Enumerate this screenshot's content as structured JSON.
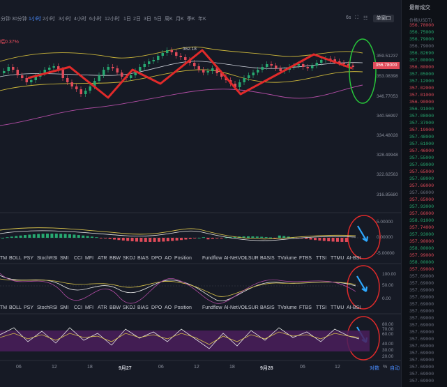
{
  "toolbar": {
    "timeframes": [
      "分钟",
      "30分钟",
      "1小时",
      "2小时",
      "3小时",
      "4小时",
      "6小时",
      "12小时",
      "1日",
      "2日",
      "3日",
      "5日",
      "周K",
      "月K",
      "季K",
      "年K"
    ],
    "active_timeframe": "1小时",
    "interval_label": "6s",
    "window_button": "单窗口"
  },
  "price": {
    "change_label": "幅0.37%",
    "current": "356.78000",
    "high_marker": "362.18"
  },
  "main_axis": [
    "359.51237",
    "356.78000",
    "353.08398",
    "346.77053",
    "340.56997",
    "334.48028",
    "328.49948",
    "322.62563",
    "316.85680"
  ],
  "macd_axis": [
    "5.00000",
    "0.00000",
    "-5.00000"
  ],
  "osc_axis": [
    "100.00",
    "50.00",
    "0.00"
  ],
  "rsi_axis": [
    "80.00",
    "70.00",
    "60.00",
    "40.00",
    "30.00",
    "20.00"
  ],
  "indicator_tabs": [
    "TM",
    "BOLL",
    "PSY",
    "StochRSI",
    "SMI",
    "CCI",
    "MFI",
    "ATR",
    "BBW",
    "SKDJ",
    "BIAS",
    "DPO",
    "AO",
    "Position",
    "Fundflow",
    "AI-NetVOL",
    "LSUR",
    "BASIS",
    "TVolume",
    "FTBS",
    "TTSI",
    "TTMU",
    "AI-BSI"
  ],
  "x_axis": [
    "06",
    "12",
    "18",
    "9月27",
    "06",
    "12",
    "18",
    "9月28",
    "06",
    "12"
  ],
  "bottom_controls": {
    "log": "对数",
    "percent": "%",
    "auto": "自动"
  },
  "side": {
    "title": "最新成交",
    "header": "价格(USDT)",
    "prices": [
      {
        "v": "356.78000",
        "d": "down"
      },
      {
        "v": "356.75000",
        "d": "up"
      },
      {
        "v": "356.79000",
        "d": "up"
      },
      {
        "v": "356.79000",
        "d": "dim"
      },
      {
        "v": "356.82690",
        "d": "up"
      },
      {
        "v": "357.00000",
        "d": "up"
      },
      {
        "v": "356.80000",
        "d": "down"
      },
      {
        "v": "357.05000",
        "d": "up"
      },
      {
        "v": "357.12000",
        "d": "up"
      },
      {
        "v": "357.02000",
        "d": "down"
      },
      {
        "v": "357.01000",
        "d": "down"
      },
      {
        "v": "356.90000",
        "d": "down"
      },
      {
        "v": "356.91000",
        "d": "up"
      },
      {
        "v": "357.08000",
        "d": "up"
      },
      {
        "v": "357.37000",
        "d": "up"
      },
      {
        "v": "357.19000",
        "d": "down"
      },
      {
        "v": "357.48000",
        "d": "up"
      },
      {
        "v": "357.61000",
        "d": "up"
      },
      {
        "v": "357.46000",
        "d": "down"
      },
      {
        "v": "357.55000",
        "d": "up"
      },
      {
        "v": "357.69000",
        "d": "up"
      },
      {
        "v": "357.65000",
        "d": "down"
      },
      {
        "v": "357.68000",
        "d": "up"
      },
      {
        "v": "357.66000",
        "d": "down"
      },
      {
        "v": "357.66000",
        "d": "dim"
      },
      {
        "v": "357.65000",
        "d": "down"
      },
      {
        "v": "357.93000",
        "d": "up"
      },
      {
        "v": "357.66000",
        "d": "down"
      },
      {
        "v": "358.01000",
        "d": "up"
      },
      {
        "v": "357.74000",
        "d": "down"
      },
      {
        "v": "357.93000",
        "d": "up"
      },
      {
        "v": "357.90000",
        "d": "down"
      },
      {
        "v": "358.00000",
        "d": "up"
      },
      {
        "v": "357.99000",
        "d": "down"
      },
      {
        "v": "358.00000",
        "d": "up"
      },
      {
        "v": "357.69000",
        "d": "down"
      },
      {
        "v": "357.69000",
        "d": "dim"
      },
      {
        "v": "357.69000",
        "d": "dim"
      },
      {
        "v": "357.69000",
        "d": "dim"
      },
      {
        "v": "357.69000",
        "d": "dim"
      },
      {
        "v": "357.69000",
        "d": "dim"
      },
      {
        "v": "357.69000",
        "d": "dim"
      },
      {
        "v": "357.69000",
        "d": "dim"
      },
      {
        "v": "357.69000",
        "d": "dim"
      },
      {
        "v": "357.69000",
        "d": "dim"
      },
      {
        "v": "357.69000",
        "d": "dim"
      },
      {
        "v": "357.69000",
        "d": "dim"
      },
      {
        "v": "357.69000",
        "d": "dim"
      },
      {
        "v": "357.69000",
        "d": "dim"
      },
      {
        "v": "357.69000",
        "d": "dim"
      },
      {
        "v": "357.69000",
        "d": "dim"
      },
      {
        "v": "357.69000",
        "d": "dim"
      }
    ]
  },
  "colors": {
    "up": "#27a971",
    "down": "#e04b5a",
    "accent": "#4a8cff"
  }
}
